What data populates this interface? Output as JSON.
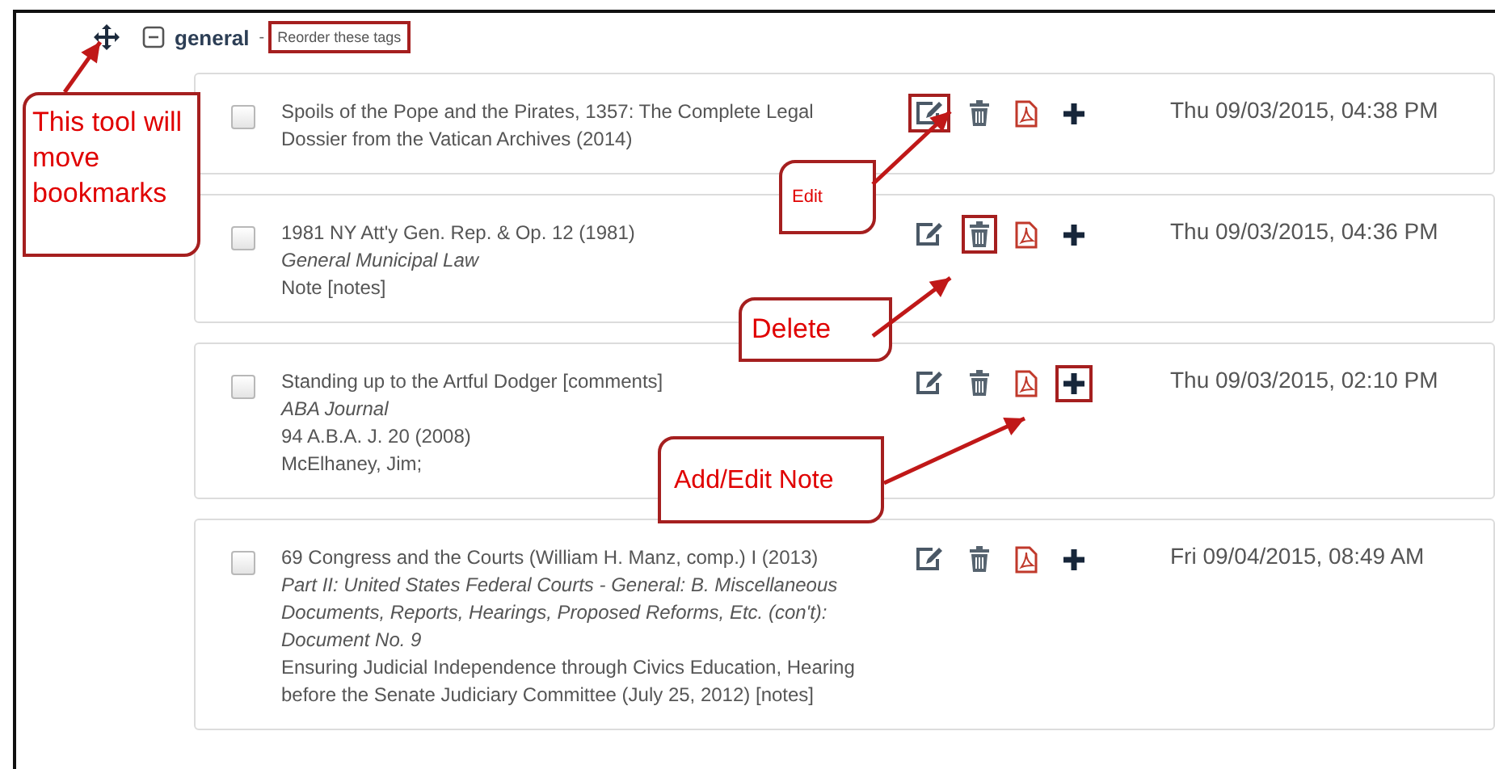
{
  "group": {
    "name": "general",
    "expanded": true,
    "separator": "-",
    "reorder_link": {
      "label": "Reorder these tags",
      "highlighted": true
    }
  },
  "bookmarks": [
    {
      "checked": false,
      "lines": [
        {
          "kind": "title",
          "text": "Spoils of the Pope and the Pirates, 1357: The Complete Legal Dossier from the Vatican Archives (2014)"
        }
      ],
      "actions": [
        {
          "kind": "edit",
          "highlighted": true
        },
        {
          "kind": "delete",
          "highlighted": false
        },
        {
          "kind": "pdf",
          "highlighted": false
        },
        {
          "kind": "note",
          "highlighted": false
        }
      ],
      "date": "Thu 09/03/2015, 04:38 PM"
    },
    {
      "checked": false,
      "lines": [
        {
          "kind": "title",
          "text": "1981 NY Att'y Gen. Rep. & Op. 12 (1981)"
        },
        {
          "kind": "source",
          "text": "General Municipal Law"
        },
        {
          "kind": "plain",
          "text": "Note [notes]"
        }
      ],
      "actions": [
        {
          "kind": "edit",
          "highlighted": false
        },
        {
          "kind": "delete",
          "highlighted": true
        },
        {
          "kind": "pdf",
          "highlighted": false
        },
        {
          "kind": "note",
          "highlighted": false
        }
      ],
      "date": "Thu 09/03/2015, 04:36 PM"
    },
    {
      "checked": false,
      "lines": [
        {
          "kind": "title",
          "text": "Standing up to the Artful Dodger [comments]"
        },
        {
          "kind": "source",
          "text": "ABA Journal"
        },
        {
          "kind": "plain",
          "text": "94 A.B.A. J. 20 (2008)"
        },
        {
          "kind": "plain",
          "text": "McElhaney, Jim;"
        }
      ],
      "actions": [
        {
          "kind": "edit",
          "highlighted": false
        },
        {
          "kind": "delete",
          "highlighted": false
        },
        {
          "kind": "pdf",
          "highlighted": false
        },
        {
          "kind": "note",
          "highlighted": true
        }
      ],
      "date": "Thu 09/03/2015, 02:10 PM"
    },
    {
      "checked": false,
      "lines": [
        {
          "kind": "title",
          "text": "69 Congress and the Courts (William H. Manz, comp.) I (2013)"
        },
        {
          "kind": "source",
          "text": "Part II: United States Federal Courts - General: B. Miscellaneous Documents, Reports, Hearings, Proposed Reforms, Etc. (con't): Document No. 9"
        },
        {
          "kind": "plain",
          "text": "Ensuring Judicial Independence through Civics Education, Hearing before the Senate Judiciary Committee (July 25, 2012) [notes]"
        }
      ],
      "actions": [
        {
          "kind": "edit",
          "highlighted": false
        },
        {
          "kind": "delete",
          "highlighted": false
        },
        {
          "kind": "pdf",
          "highlighted": false
        },
        {
          "kind": "note",
          "highlighted": false
        }
      ],
      "date": "Fri 09/04/2015, 08:49 AM"
    }
  ],
  "callouts": [
    {
      "text": "This tool will move bookmarks"
    },
    {
      "text": "Edit"
    },
    {
      "text": "Delete"
    },
    {
      "text": "Add/Edit Note"
    }
  ]
}
